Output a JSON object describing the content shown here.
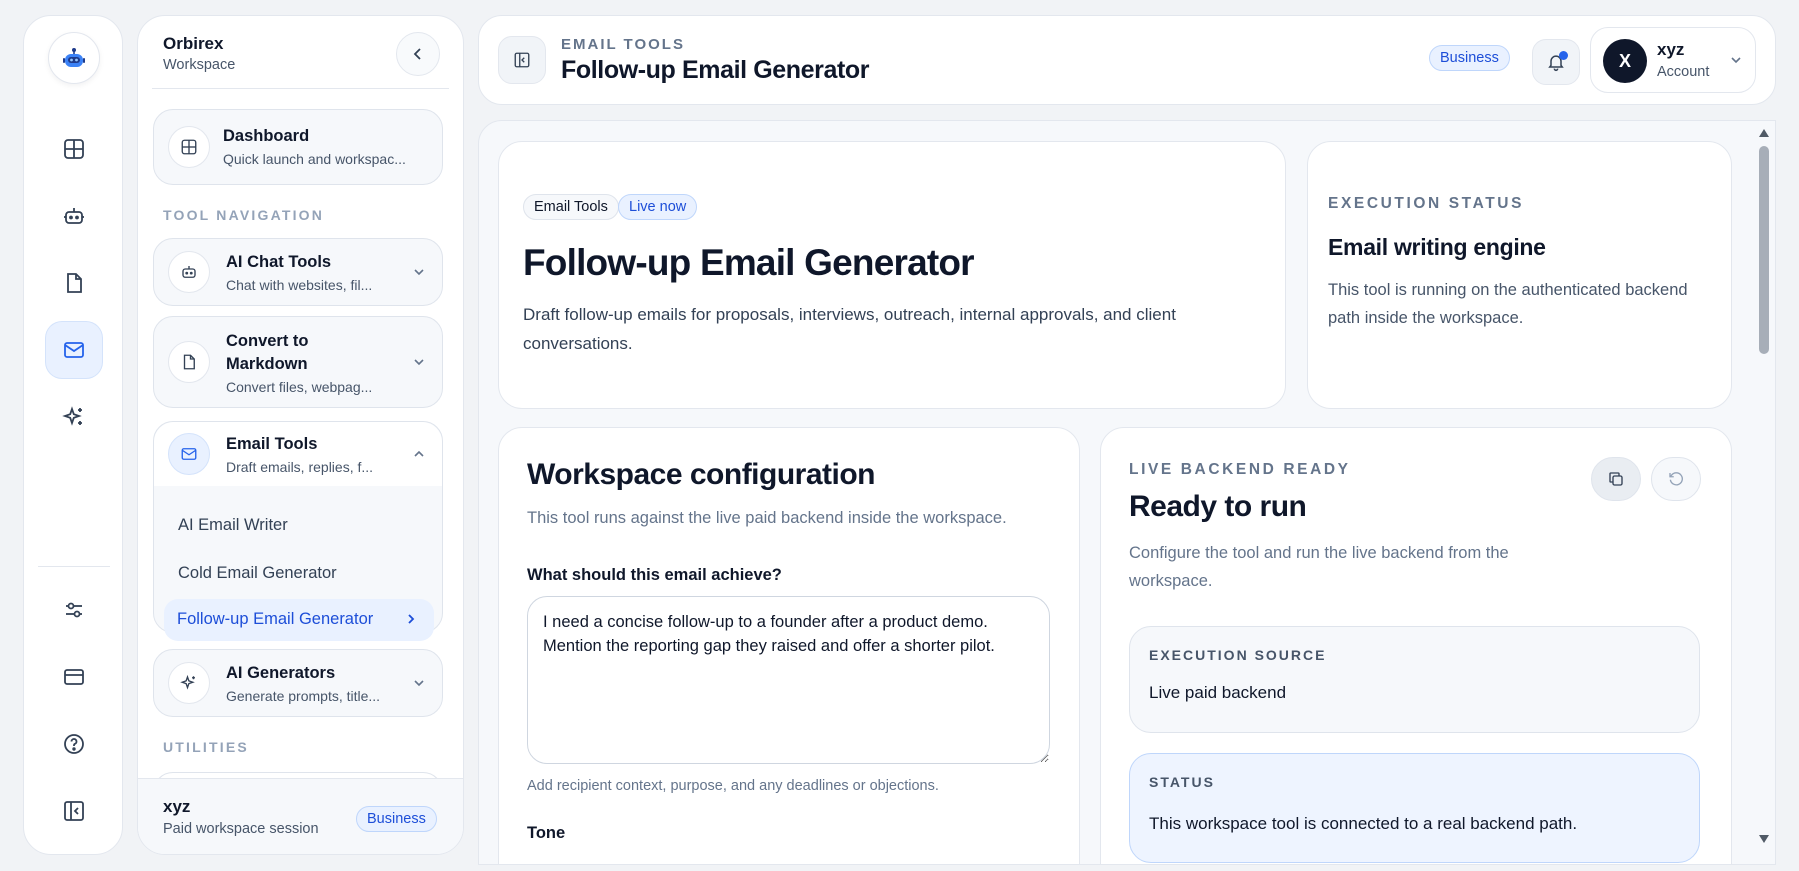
{
  "workspace": {
    "name": "Orbirex",
    "subtitle": "Workspace"
  },
  "sidebar": {
    "section_tools": "TOOL NAVIGATION",
    "section_utilities": "UTILITIES",
    "dashboard": {
      "title": "Dashboard",
      "subtitle": "Quick launch and workspac..."
    },
    "groups": [
      {
        "title": "AI Chat Tools",
        "subtitle": "Chat with websites, fil..."
      },
      {
        "title": "Convert to",
        "title2": "Markdown",
        "subtitle": "Convert files, webpag..."
      },
      {
        "title": "Email Tools",
        "subtitle": "Draft emails, replies, f..."
      },
      {
        "title": "AI Generators",
        "subtitle": "Generate prompts, title..."
      }
    ],
    "email_items": [
      "AI Email Writer",
      "Cold Email Generator",
      "Follow-up Email Generator"
    ],
    "footer": {
      "name": "xyz",
      "subtitle": "Paid workspace session",
      "badge": "Business"
    }
  },
  "header": {
    "eyebrow": "EMAIL TOOLS",
    "title": "Follow-up Email Generator",
    "badge": "Business",
    "account": {
      "initial": "X",
      "name": "xyz",
      "subtitle": "Account"
    }
  },
  "hero": {
    "pills": [
      "Email Tools",
      "Live now"
    ],
    "title": "Follow-up Email Generator",
    "description": "Draft follow-up emails for proposals, interviews, outreach, internal approvals, and client conversations."
  },
  "execution_status": {
    "eyebrow": "EXECUTION STATUS",
    "title": "Email writing engine",
    "description": "This tool is running on the authenticated backend path inside the workspace."
  },
  "config": {
    "title": "Workspace configuration",
    "description": "This tool runs against the live paid backend inside the workspace.",
    "goal_label": "What should this email achieve?",
    "goal_value": "I need a concise follow-up to a founder after a product demo. Mention the reporting gap they raised and offer a shorter pilot.",
    "goal_hint": "Add recipient context, purpose, and any deadlines or objections.",
    "tone_label": "Tone"
  },
  "run": {
    "eyebrow": "LIVE BACKEND READY",
    "title": "Ready to run",
    "description": "Configure the tool and run the live backend from the workspace.",
    "source_label": "EXECUTION SOURCE",
    "source_value": "Live paid backend",
    "status_label": "STATUS",
    "status_value": "This workspace tool is connected to a real backend path."
  },
  "colors": {
    "accent": "#2563eb",
    "accent_bg": "#e9f1ff",
    "text": "#0f172a",
    "muted": "#64748b"
  }
}
